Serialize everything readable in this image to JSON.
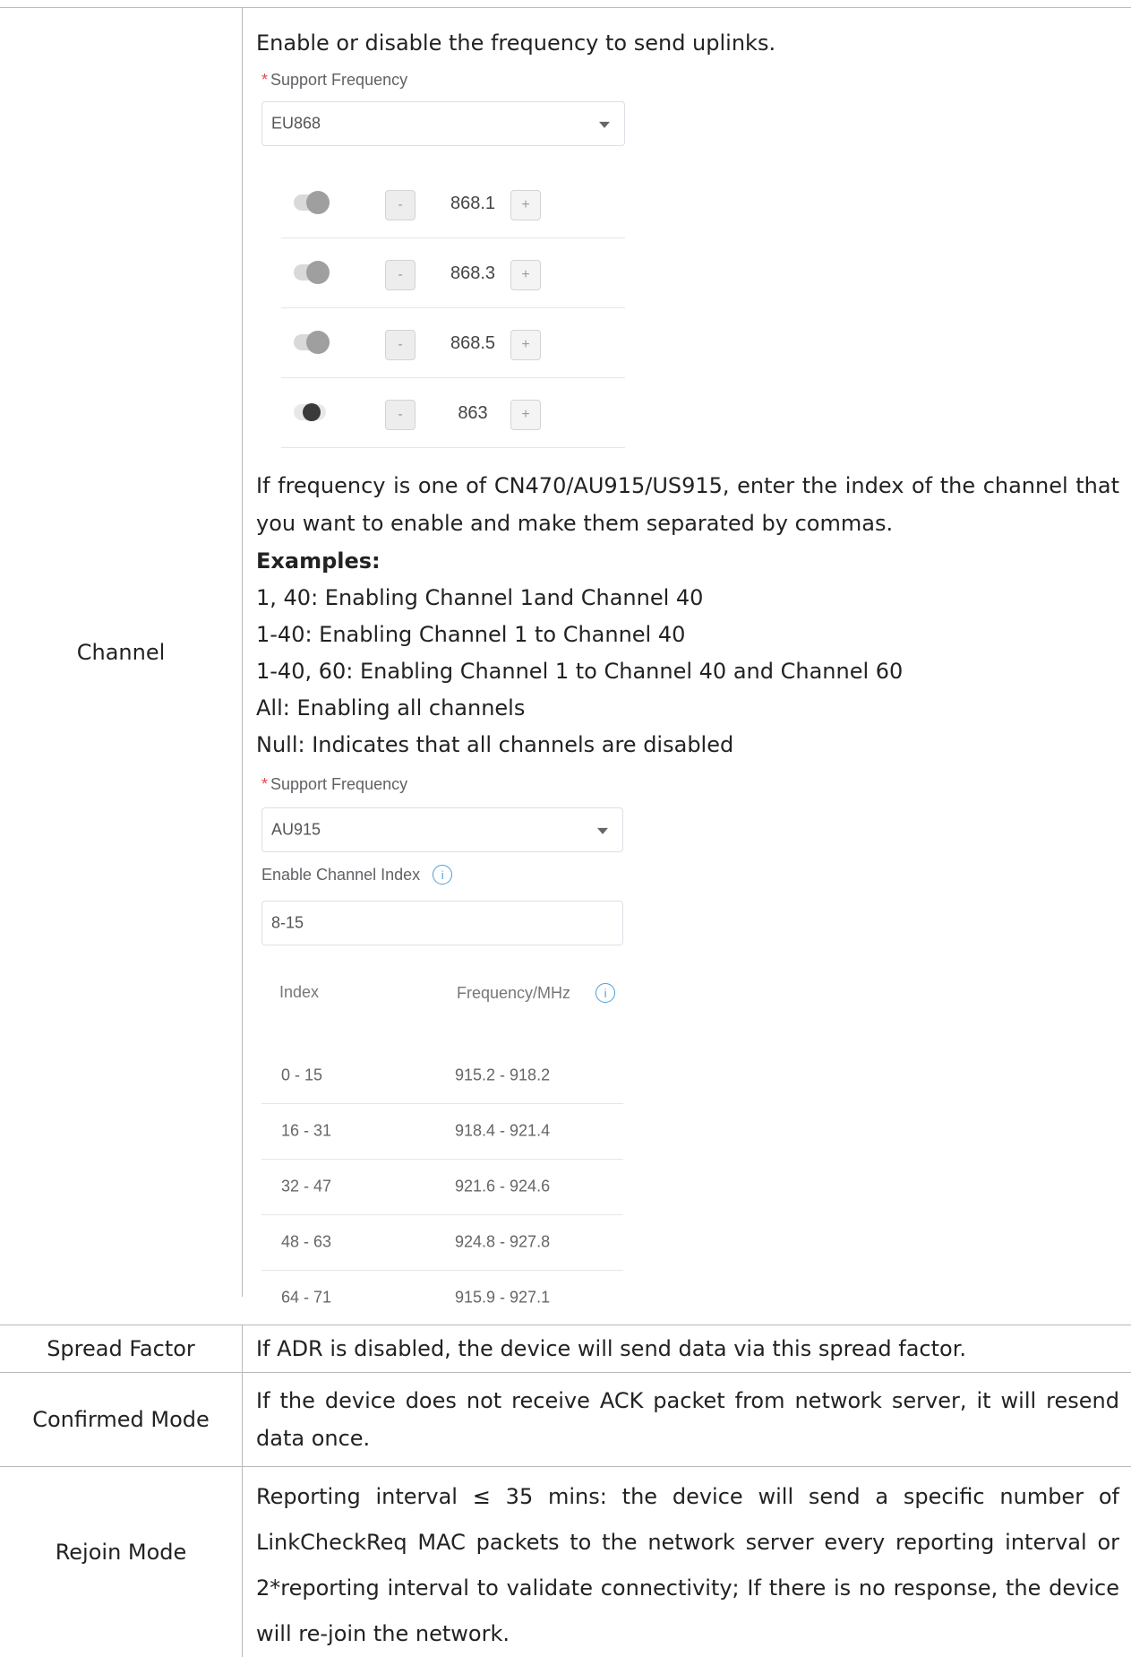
{
  "rows": [
    {
      "name": "Channel",
      "intro": "Enable or disable the frequency to send uplinks.",
      "eu_form": {
        "label": "Support Frequency",
        "select_value": "EU868",
        "frequencies": [
          {
            "value": "868.1",
            "enabled": true
          },
          {
            "value": "868.3",
            "enabled": true
          },
          {
            "value": "868.5",
            "enabled": true
          },
          {
            "value": "863",
            "enabled": false
          }
        ],
        "minus": "-",
        "plus": "+"
      },
      "cn_text": "If frequency is one of CN470/AU915/US915, enter the index of the channel that you want to enable and make them separated by commas.",
      "examples_heading": "Examples:",
      "examples": [
        "1, 40: Enabling Channel 1and Channel 40",
        "1-40: Enabling Channel 1 to Channel 40",
        "1-40, 60: Enabling Channel 1 to Channel 40 and Channel 60",
        "All: Enabling all channels",
        "Null: Indicates that all channels are disabled"
      ],
      "au_form": {
        "label": "Support Frequency",
        "select_value": "AU915",
        "index_label": "Enable Channel Index",
        "index_value": "8-15",
        "table_headers": [
          "Index",
          "Frequency/MHz"
        ],
        "table_rows": [
          [
            "0 - 15",
            "915.2 - 918.2"
          ],
          [
            "16 - 31",
            "918.4 - 921.4"
          ],
          [
            "32 - 47",
            "921.6 - 924.6"
          ],
          [
            "48 - 63",
            "924.8 - 927.8"
          ],
          [
            "64 - 71",
            "915.9 - 927.1"
          ]
        ]
      }
    },
    {
      "name": "Spread Factor",
      "desc": "If ADR is disabled, the device will send data via this spread factor."
    },
    {
      "name": "Confirmed Mode",
      "desc": "If the device does not receive ACK packet from network server, it will resend data once."
    },
    {
      "name": "Rejoin Mode",
      "desc": "Reporting interval ≤ 35 mins: the device will send a specific number of LinkCheckReq MAC packets to the network server every reporting interval or 2*reporting interval to validate connectivity; If there is no response, the device will re-join the network."
    }
  ]
}
